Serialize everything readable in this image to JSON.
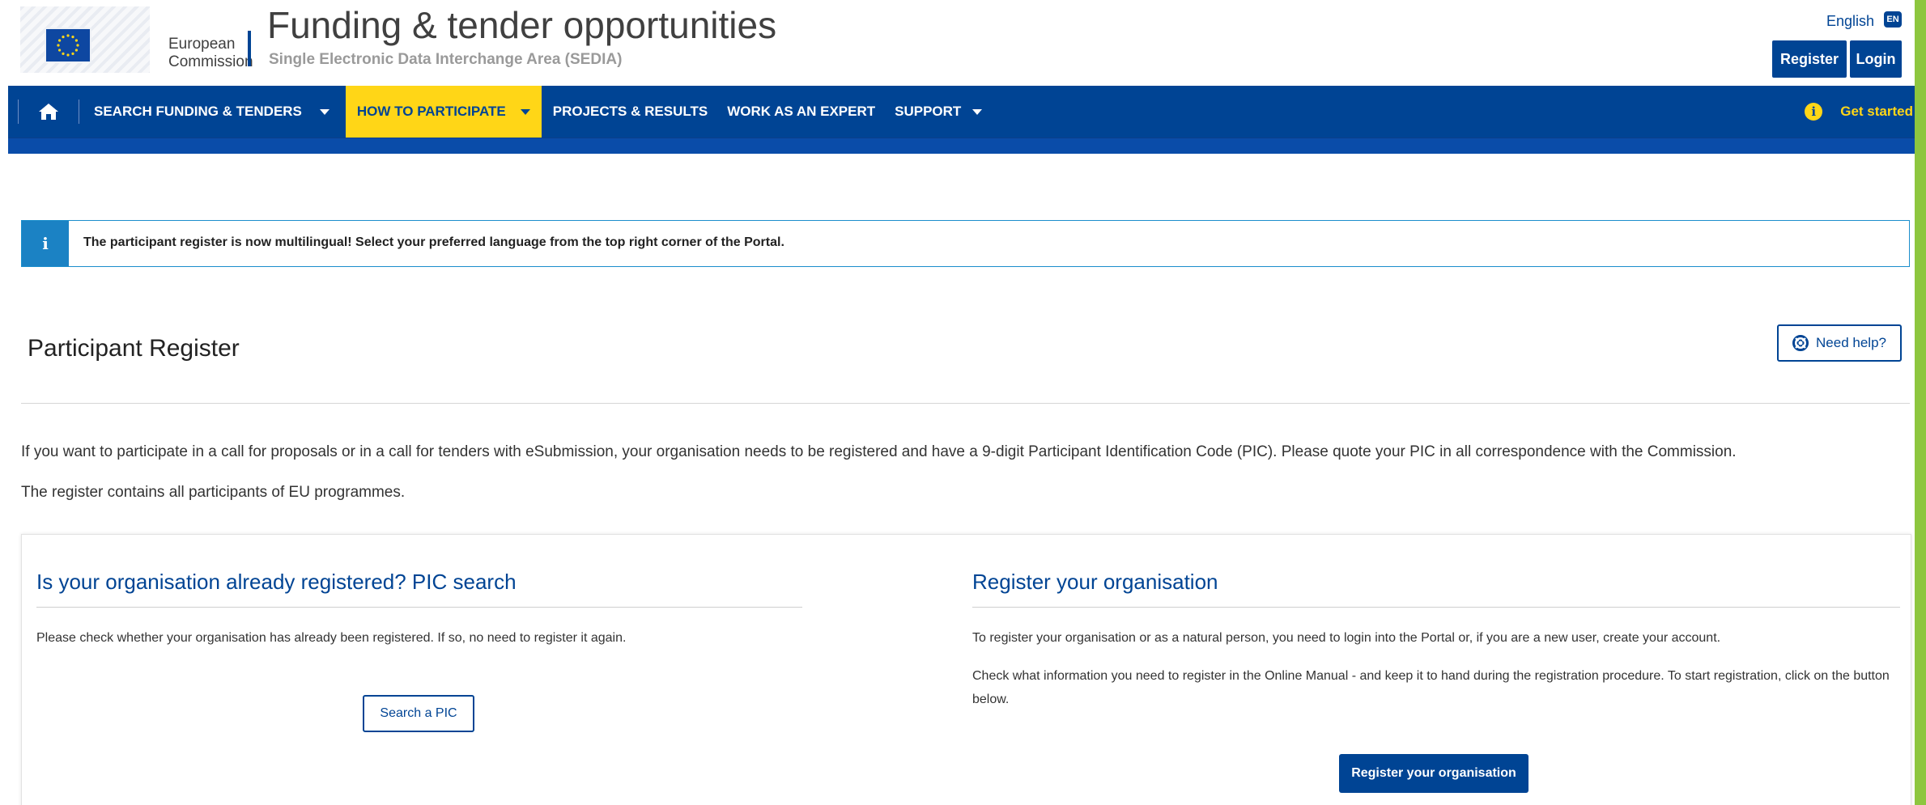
{
  "header": {
    "logo_line1": "European",
    "logo_line2": "Commission",
    "title": "Funding & tender opportunities",
    "subtitle": "Single Electronic Data Interchange Area (SEDIA)",
    "language": "English",
    "language_code": "EN",
    "register_label": "Register",
    "login_label": "Login"
  },
  "nav": {
    "home_icon": "home-icon",
    "items": [
      {
        "label": "SEARCH FUNDING & TENDERS",
        "dropdown": true,
        "active": false
      },
      {
        "label": "HOW TO PARTICIPATE",
        "dropdown": true,
        "active": true
      },
      {
        "label": "PROJECTS & RESULTS",
        "dropdown": false,
        "active": false
      },
      {
        "label": "WORK AS AN EXPERT",
        "dropdown": false,
        "active": false
      },
      {
        "label": "SUPPORT",
        "dropdown": true,
        "active": false
      }
    ],
    "get_started": "Get started"
  },
  "notice": {
    "icon": "info-icon",
    "text": "The participant register is now multilingual! Select your preferred language from the top right corner of the Portal."
  },
  "page": {
    "title": "Participant Register",
    "help_label": "Need help?",
    "intro1": "If you want to participate in a call for proposals or in a call for tenders with eSubmission, your organisation needs to be registered and have a 9-digit Participant Identification Code (PIC). Please quote your PIC in all correspondence with the Commission.",
    "intro2": "The register contains all participants of EU programmes."
  },
  "left_col": {
    "title": "Is your organisation already registered? PIC search",
    "text": "Please check whether your organisation has already been registered. If so, no need to register it again.",
    "button": "Search a PIC"
  },
  "right_col": {
    "title": "Register your organisation",
    "text1": "To register your organisation or as a natural person, you need to login into the Portal or, if you are a new user, create your account.",
    "text2": "Check what information you need to register in the Online Manual - and keep it to hand during the registration procedure. To start registration, click on the button below.",
    "button": "Register your organisation"
  },
  "colors": {
    "primary": "#004494",
    "accent_yellow": "#ffd617",
    "info_blue": "#1b82c4",
    "right_strip": "#8dc63f"
  }
}
